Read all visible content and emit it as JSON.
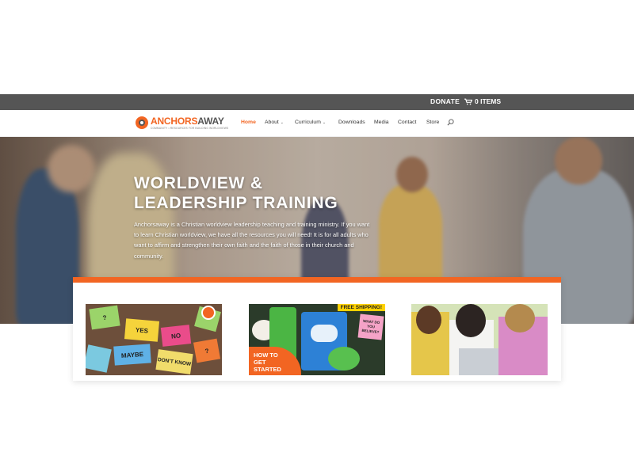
{
  "topbar": {
    "donate_label": "DONATE",
    "cart_label": "0 ITEMS"
  },
  "brand": {
    "name_part1": "ANCHORS",
    "name_part2": "AWAY",
    "tagline": "COMMUNITY • RESOURCES FOR BUILDING WORLDVIEWS",
    "accent": "#f26522"
  },
  "nav": [
    {
      "label": "Home",
      "active": true,
      "has_dropdown": false
    },
    {
      "label": "About",
      "active": false,
      "has_dropdown": true
    },
    {
      "label": "Curriculum",
      "active": false,
      "has_dropdown": true
    },
    {
      "label": "Downloads",
      "active": false,
      "has_dropdown": false
    },
    {
      "label": "Media",
      "active": false,
      "has_dropdown": false
    },
    {
      "label": "Contact",
      "active": false,
      "has_dropdown": false
    },
    {
      "label": "Store",
      "active": false,
      "has_dropdown": false
    }
  ],
  "hero": {
    "title_line1": "WORLDVIEW &",
    "title_line2": "LEADERSHIP TRAINING",
    "lede": "Anchorsaway is a Christian worldview leadership teaching and training ministry. If you want to learn Christian worldview, we have all the resources you will need! It is for all adults who want to affirm and strengthen their own faith and the faith of those in their church and community."
  },
  "cards": {
    "card1": {
      "notes": [
        "?",
        "YES",
        "NO",
        "MAYBE",
        "DON'T KNOW",
        "?"
      ]
    },
    "card2": {
      "badge": "FREE SHIPPING!",
      "sticky": "WHAT DO YOU BELIEVE?",
      "cta_line1": "HOW TO",
      "cta_line2": "GET",
      "cta_line3": "STARTED"
    }
  }
}
